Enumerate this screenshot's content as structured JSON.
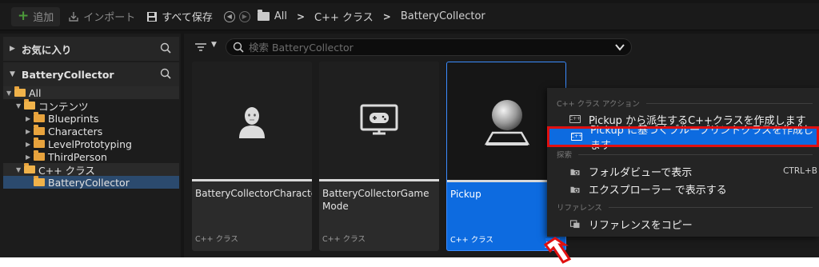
{
  "toolbar": {
    "add_label": "追加",
    "import_label": "インポート",
    "save_all_label": "すべて保存",
    "breadcrumb": [
      "All",
      "C++ クラス",
      "BatteryCollector"
    ]
  },
  "left_panel": {
    "favorites_label": "お気に入り",
    "project_label": "BatteryCollector",
    "tree": [
      {
        "label": "All",
        "depth": 0,
        "expanded": true
      },
      {
        "label": "コンテンツ",
        "depth": 1,
        "expanded": true
      },
      {
        "label": "Blueprints",
        "depth": 2,
        "expanded": false
      },
      {
        "label": "Characters",
        "depth": 2,
        "expanded": false
      },
      {
        "label": "LevelPrototyping",
        "depth": 2,
        "expanded": false
      },
      {
        "label": "ThirdPerson",
        "depth": 2,
        "expanded": false
      },
      {
        "label": "C++ クラス",
        "depth": 1,
        "expanded": true
      },
      {
        "label": "BatteryCollector",
        "depth": 2,
        "selected": true
      }
    ]
  },
  "search": {
    "placeholder": "検索 BatteryCollector"
  },
  "assets": [
    {
      "name": "BatteryCollectorCharacter",
      "type": "C++ クラス",
      "icon": "character-icon"
    },
    {
      "name": "BatteryCollectorGame Mode",
      "type": "C++ クラス",
      "icon": "game-mode-icon"
    },
    {
      "name": "Pickup",
      "type": "C++ クラス",
      "icon": "sphere-actor-icon",
      "selected": true
    }
  ],
  "context_menu": {
    "section_cpp": "C++ クラス アクション",
    "item_derive_cpp": "Pickup から派生するC++クラスを作成します",
    "item_create_bp": "Pickup に基づくブループリントクラスを作成します",
    "section_explore": "探索",
    "item_folder_view": "フォルダビューで表示",
    "item_folder_view_shortcut": "CTRL+B",
    "item_explorer": "エクスプローラー で表示する",
    "section_reference": "リファレンス",
    "item_copy_reference": "リファレンスをコピー"
  },
  "colors": {
    "accent_blue": "#0d6be0",
    "highlight_red": "#e01010",
    "folder_orange": "#e8a33d",
    "add_green": "#4c9a3a"
  }
}
